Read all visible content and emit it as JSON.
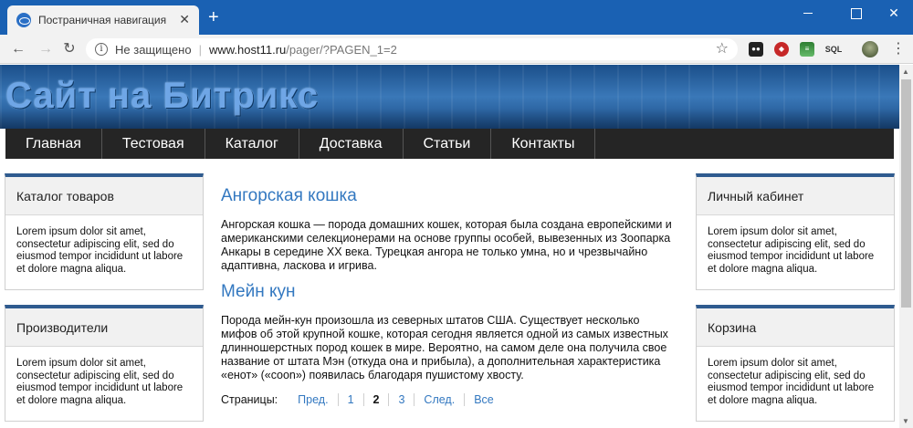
{
  "browser": {
    "tab_title": "Постраничная навигация",
    "security_text": "Не защищено",
    "url_host": "www.host11.ru",
    "url_path": "/pager/?PAGEN_1=2",
    "ext_sql_label": "SQL"
  },
  "site": {
    "title": "Сайт на Битрикс",
    "menu": [
      {
        "label": "Главная"
      },
      {
        "label": "Тестовая"
      },
      {
        "label": "Каталог"
      },
      {
        "label": "Доставка"
      },
      {
        "label": "Статьи"
      },
      {
        "label": "Контакты"
      }
    ]
  },
  "left_boxes": [
    {
      "title": "Каталог товаров",
      "text": "Lorem ipsum dolor sit amet, consectetur adipiscing elit, sed do eiusmod tempor incididunt ut labore et dolore magna aliqua."
    },
    {
      "title": "Производители",
      "text": "Lorem ipsum dolor sit amet, consectetur adipiscing elit, sed do eiusmod tempor incididunt ut labore et dolore magna aliqua."
    }
  ],
  "right_boxes": [
    {
      "title": "Личный кабинет",
      "text": "Lorem ipsum dolor sit amet, consectetur adipiscing elit, sed do eiusmod tempor incididunt ut labore et dolore magna aliqua."
    },
    {
      "title": "Корзина",
      "text": "Lorem ipsum dolor sit amet, consectetur adipiscing elit, sed do eiusmod tempor incididunt ut labore et dolore magna aliqua."
    }
  ],
  "articles": [
    {
      "title": "Ангорская кошка",
      "text": "Ангорская кошка — порода домашних кошек, которая была создана европейскими и американскими селекционерами на основе группы особей, вывезенных из Зоопарка Анкары в середине XX века. Турецкая ангора не только умна, но и чрезвычайно адаптивна, ласкова и игрива."
    },
    {
      "title": "Мейн кун",
      "text": "Порода мейн-кун произошла из северных штатов США. Существует несколько мифов об этой крупной кошке, которая сегодня является одной из самых известных длинношерстных пород кошек в мире. Вероятно, на самом деле она получила свое название от штата Мэн (откуда она и прибыла), а дополнительная характеристика «енот» («coon») появилась благодаря пушистому хвосту."
    }
  ],
  "pager": {
    "label": "Страницы:",
    "prev": "Пред.",
    "page1": "1",
    "current": "2",
    "page3": "3",
    "next": "След.",
    "all": "Все"
  },
  "colors": {
    "browser_frame": "#1a61b3",
    "link": "#3378c0",
    "menu_bg": "#252525",
    "box_accent": "#2f5b8f"
  }
}
